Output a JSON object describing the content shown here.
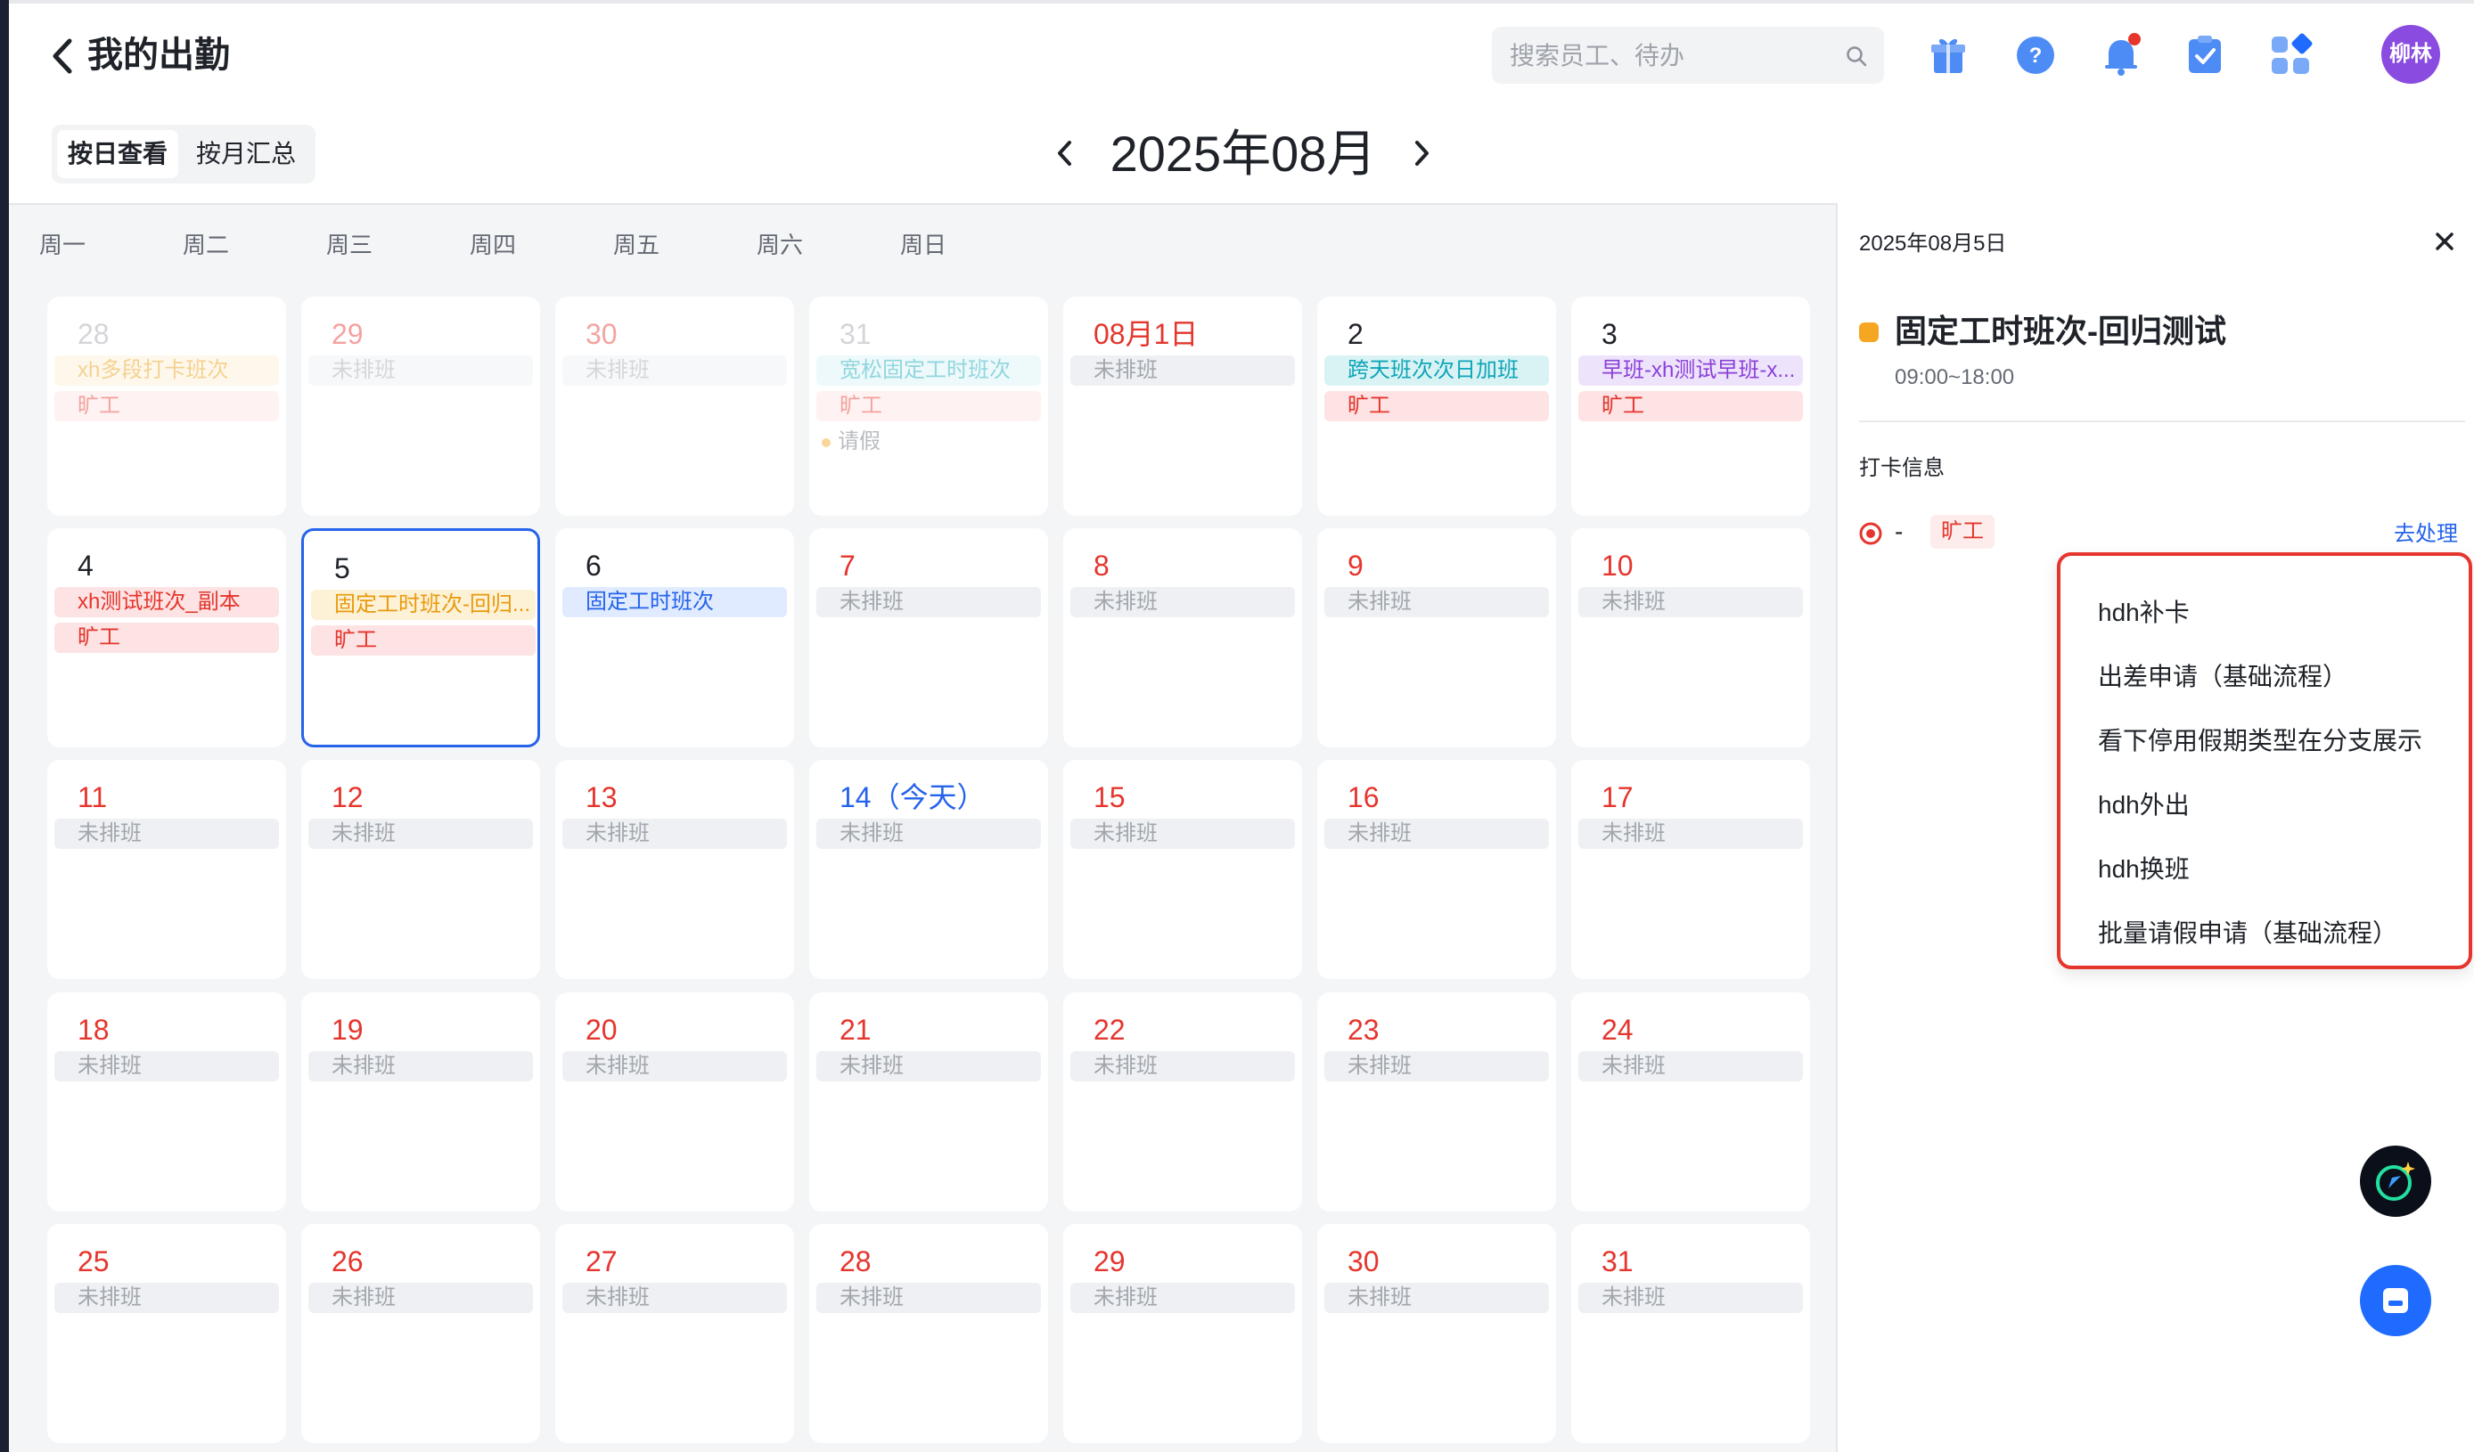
{
  "header": {
    "title": "我的出勤",
    "search_placeholder": "搜索员工、待办",
    "icons": [
      "gift-icon",
      "help-icon",
      "bell-icon",
      "task-icon",
      "apps-icon"
    ],
    "avatar_text": "柳林"
  },
  "toolbar": {
    "view_by_day": "按日查看",
    "view_by_month": "按月汇总",
    "month_label": "2025年08月"
  },
  "weekdays": [
    "周一",
    "周二",
    "周三",
    "周四",
    "周五",
    "周六",
    "周日"
  ],
  "colors": {
    "red": "#e5352d",
    "blue": "#2563eb",
    "orange": "#f5a623",
    "cyan_tag_bg": "#d9f3f5",
    "cyan_tag_text": "#0ea5b7",
    "purple_tag_bg": "#ede4fb",
    "purple_tag_text": "#8b3fd9",
    "blue_tag_bg": "#e0ebff",
    "yellow_tag_bg": "#fdf1d6",
    "yellow_tag_text": "#e89a0c",
    "gray_tag_bg": "#eef0f3",
    "gray_tag_text": "#a2a7ae",
    "absent_bg": "#fde3e3",
    "absent_text": "#e5352d"
  },
  "calendar": {
    "weeks": [
      [
        {
          "num": "28",
          "faded": true,
          "numColor": "gray",
          "tags": [
            {
              "text": "xh多段打卡班次",
              "style": "yellow"
            },
            {
              "text": "旷工",
              "style": "absent"
            }
          ]
        },
        {
          "num": "29",
          "faded": true,
          "numColor": "red",
          "tags": [
            {
              "text": "未排班",
              "style": "gray"
            }
          ]
        },
        {
          "num": "30",
          "faded": true,
          "numColor": "red",
          "tags": [
            {
              "text": "未排班",
              "style": "gray"
            }
          ]
        },
        {
          "num": "31",
          "faded": true,
          "numColor": "gray",
          "tags": [
            {
              "text": "宽松固定工时班次",
              "style": "cyan"
            },
            {
              "text": "旷工",
              "style": "absent"
            }
          ],
          "leave": "请假"
        },
        {
          "num": "08月1日",
          "numColor": "red",
          "tags": [
            {
              "text": "未排班",
              "style": "gray"
            }
          ]
        },
        {
          "num": "2",
          "numColor": "black",
          "tags": [
            {
              "text": "跨天班次次日加班",
              "style": "cyan"
            },
            {
              "text": "旷工",
              "style": "absent"
            }
          ]
        },
        {
          "num": "3",
          "numColor": "black",
          "tags": [
            {
              "text": "早班-xh测试早班-x...",
              "style": "purple"
            },
            {
              "text": "旷工",
              "style": "absent"
            }
          ]
        }
      ],
      [
        {
          "num": "4",
          "numColor": "black",
          "tags": [
            {
              "text": "xh测试班次_副本",
              "style": "absent"
            },
            {
              "text": "旷工",
              "style": "absent"
            }
          ]
        },
        {
          "num": "5",
          "numColor": "black",
          "selected": true,
          "tags": [
            {
              "text": "固定工时班次-回归...",
              "style": "yellow"
            },
            {
              "text": "旷工",
              "style": "absent"
            }
          ]
        },
        {
          "num": "6",
          "numColor": "black",
          "tags": [
            {
              "text": "固定工时班次",
              "style": "blue"
            }
          ]
        },
        {
          "num": "7",
          "numColor": "red",
          "tags": [
            {
              "text": "未排班",
              "style": "gray"
            }
          ]
        },
        {
          "num": "8",
          "numColor": "red",
          "tags": [
            {
              "text": "未排班",
              "style": "gray"
            }
          ]
        },
        {
          "num": "9",
          "numColor": "red",
          "tags": [
            {
              "text": "未排班",
              "style": "gray"
            }
          ]
        },
        {
          "num": "10",
          "numColor": "red",
          "tags": [
            {
              "text": "未排班",
              "style": "gray"
            }
          ]
        }
      ],
      [
        {
          "num": "11",
          "numColor": "red",
          "tags": [
            {
              "text": "未排班",
              "style": "gray"
            }
          ]
        },
        {
          "num": "12",
          "numColor": "red",
          "tags": [
            {
              "text": "未排班",
              "style": "gray"
            }
          ]
        },
        {
          "num": "13",
          "numColor": "red",
          "tags": [
            {
              "text": "未排班",
              "style": "gray"
            }
          ]
        },
        {
          "num": "14（今天）",
          "numColor": "blue",
          "tags": [
            {
              "text": "未排班",
              "style": "gray"
            }
          ]
        },
        {
          "num": "15",
          "numColor": "red",
          "tags": [
            {
              "text": "未排班",
              "style": "gray"
            }
          ]
        },
        {
          "num": "16",
          "numColor": "red",
          "tags": [
            {
              "text": "未排班",
              "style": "gray"
            }
          ]
        },
        {
          "num": "17",
          "numColor": "red",
          "tags": [
            {
              "text": "未排班",
              "style": "gray"
            }
          ]
        }
      ],
      [
        {
          "num": "18",
          "numColor": "red",
          "tags": [
            {
              "text": "未排班",
              "style": "gray"
            }
          ]
        },
        {
          "num": "19",
          "numColor": "red",
          "tags": [
            {
              "text": "未排班",
              "style": "gray"
            }
          ]
        },
        {
          "num": "20",
          "numColor": "red",
          "tags": [
            {
              "text": "未排班",
              "style": "gray"
            }
          ]
        },
        {
          "num": "21",
          "numColor": "red",
          "tags": [
            {
              "text": "未排班",
              "style": "gray"
            }
          ]
        },
        {
          "num": "22",
          "numColor": "red",
          "tags": [
            {
              "text": "未排班",
              "style": "gray"
            }
          ]
        },
        {
          "num": "23",
          "numColor": "red",
          "tags": [
            {
              "text": "未排班",
              "style": "gray"
            }
          ]
        },
        {
          "num": "24",
          "numColor": "red",
          "tags": [
            {
              "text": "未排班",
              "style": "gray"
            }
          ]
        }
      ],
      [
        {
          "num": "25",
          "numColor": "red",
          "tags": [
            {
              "text": "未排班",
              "style": "gray"
            }
          ]
        },
        {
          "num": "26",
          "numColor": "red",
          "tags": [
            {
              "text": "未排班",
              "style": "gray"
            }
          ]
        },
        {
          "num": "27",
          "numColor": "red",
          "tags": [
            {
              "text": "未排班",
              "style": "gray"
            }
          ]
        },
        {
          "num": "28",
          "numColor": "red",
          "tags": [
            {
              "text": "未排班",
              "style": "gray"
            }
          ]
        },
        {
          "num": "29",
          "numColor": "red",
          "tags": [
            {
              "text": "未排班",
              "style": "gray"
            }
          ]
        },
        {
          "num": "30",
          "numColor": "red",
          "tags": [
            {
              "text": "未排班",
              "style": "gray"
            }
          ]
        },
        {
          "num": "31",
          "numColor": "red",
          "tags": [
            {
              "text": "未排班",
              "style": "gray"
            }
          ]
        }
      ]
    ]
  },
  "detail": {
    "date": "2025年08月5日",
    "shift_name": "固定工时班次-回归测试",
    "shift_time": "09:00~18:00",
    "punch_title": "打卡信息",
    "punch_dash": "-",
    "punch_status": "旷工",
    "process_link": "去处理",
    "menu_items": [
      "hdh补卡",
      "出差申请（基础流程）",
      "看下停用假期类型在分支展示",
      "hdh外出",
      "hdh换班",
      "批量请假申请（基础流程）"
    ]
  }
}
